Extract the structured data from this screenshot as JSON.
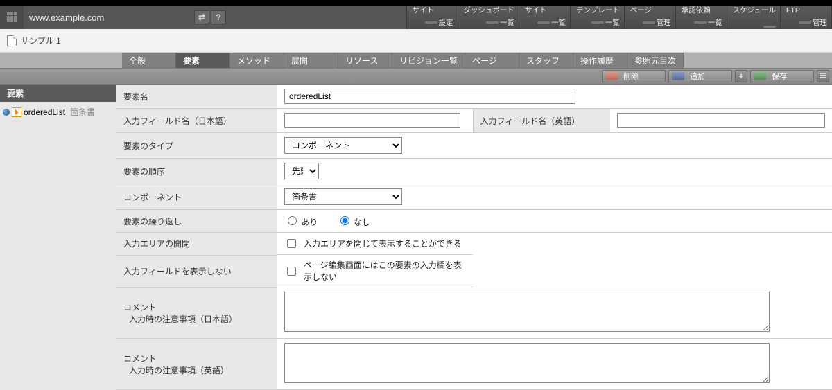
{
  "domain": "www.example.com",
  "breadcrumb": "サンプル 1",
  "nav": [
    {
      "title": "サイト",
      "sub": "設定"
    },
    {
      "title": "ダッシュボード",
      "sub": "一覧"
    },
    {
      "title": "サイト",
      "sub": "一覧"
    },
    {
      "title": "テンプレート",
      "sub": "一覧"
    },
    {
      "title": "ページ",
      "sub": "管理"
    },
    {
      "title": "承認依頼",
      "sub": "一覧"
    },
    {
      "title": "スケジュール",
      "sub": ""
    },
    {
      "title": "FTP",
      "sub": "管理"
    }
  ],
  "tabs": {
    "items": [
      "全般",
      "要素",
      "メソッド",
      "展開",
      "リソース",
      "リビジョン一覧",
      "ページ",
      "スタッフ",
      "操作履歴",
      "参照元目次"
    ],
    "active_index": 1
  },
  "actions": {
    "delete": "削除",
    "add": "追加",
    "save": "保存"
  },
  "sidebar": {
    "header": "要素",
    "item": {
      "name": "orderedList",
      "note": "箇条書"
    }
  },
  "form": {
    "element_name": {
      "label": "要素名",
      "value": "orderedList"
    },
    "field_ja": {
      "label": "入力フィールド名（日本語）",
      "value": ""
    },
    "field_en": {
      "label": "入力フィールド名（英語）",
      "value": ""
    },
    "type": {
      "label": "要素のタイプ",
      "value": "コンポーネント"
    },
    "order": {
      "label": "要素の順序",
      "value": "先頭"
    },
    "component": {
      "label": "コンポーネント",
      "value": "箇条書"
    },
    "repeat": {
      "label": "要素の繰り返し",
      "opt_yes": "あり",
      "opt_no": "なし",
      "value": "no"
    },
    "collapse": {
      "label": "入力エリアの開閉",
      "text": "入力エリアを閉じて表示することができる",
      "checked": false
    },
    "hide_field": {
      "label": "入力フィールドを表示しない",
      "text": "ページ編集画面にはこの要素の入力欄を表示しない",
      "checked": false
    },
    "comment_ja": {
      "label1": "コメント",
      "label2": "入力時の注意事項（日本語）",
      "value": ""
    },
    "comment_en": {
      "label1": "コメント",
      "label2": "入力時の注意事項（英語）",
      "value": ""
    }
  }
}
